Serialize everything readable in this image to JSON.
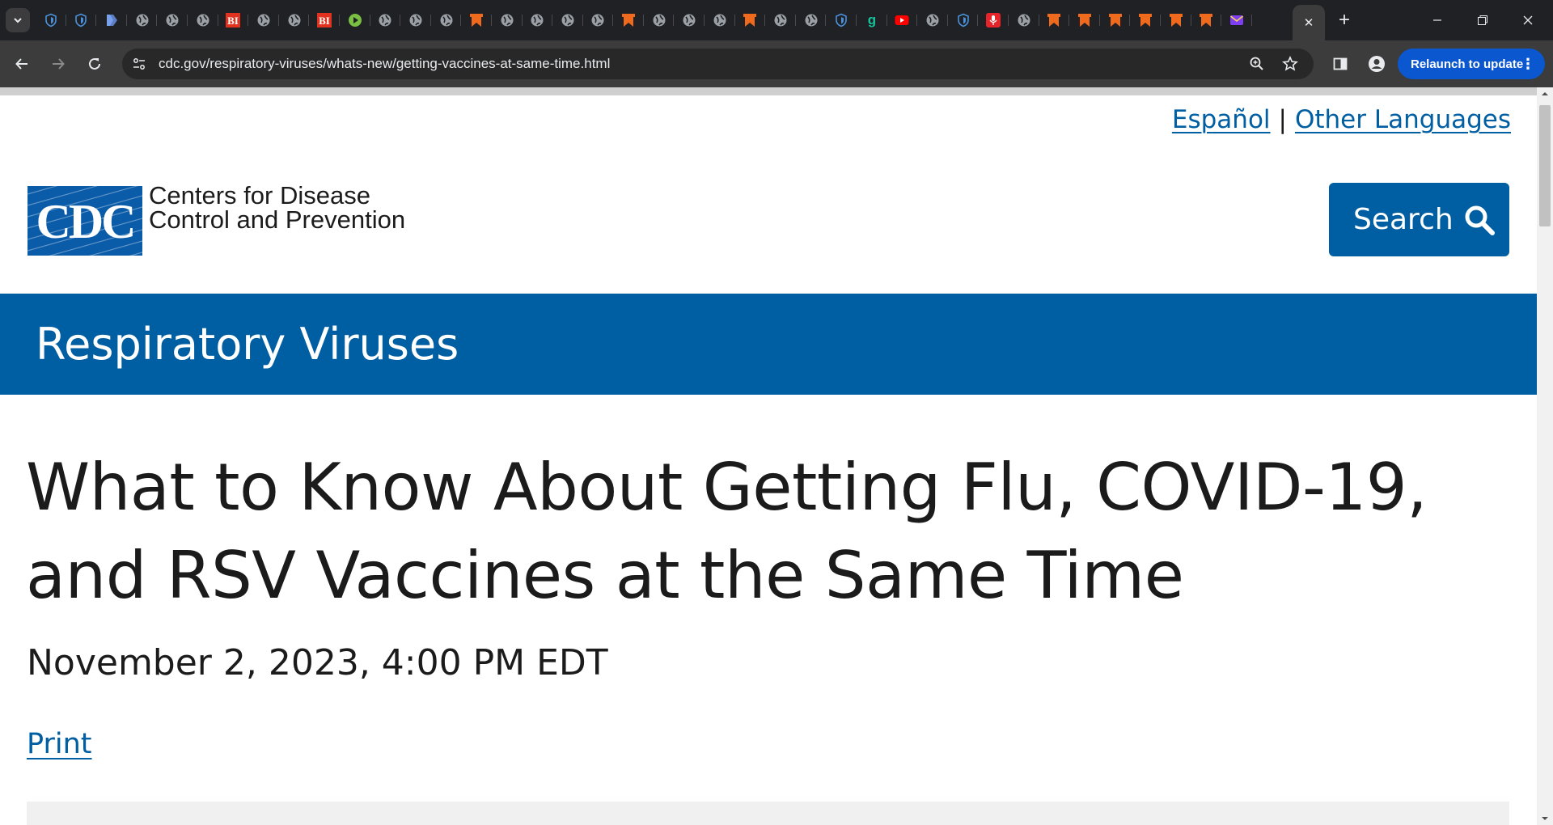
{
  "browser": {
    "tab_list_icon": "chevron-down-icon",
    "pinned_tabs": [
      {
        "icon": "shield-icon",
        "color": "#4a90d9"
      },
      {
        "icon": "shield-icon",
        "color": "#4a90d9"
      },
      {
        "icon": "bookmark-tag-icon",
        "color": "#5b7fc7"
      },
      {
        "icon": "globe-icon",
        "color": "#9aa0a6"
      },
      {
        "icon": "globe-icon",
        "color": "#9aa0a6"
      },
      {
        "icon": "globe-icon",
        "color": "#9aa0a6"
      },
      {
        "icon": "business-insider-icon",
        "color": "#e0321e",
        "text": "BI"
      },
      {
        "icon": "globe-icon",
        "color": "#9aa0a6"
      },
      {
        "icon": "globe-icon",
        "color": "#9aa0a6"
      },
      {
        "icon": "business-insider-icon",
        "color": "#e0321e",
        "text": "BI"
      },
      {
        "icon": "play-icon",
        "color": "#7ac043"
      },
      {
        "icon": "globe-icon",
        "color": "#9aa0a6"
      },
      {
        "icon": "globe-icon",
        "color": "#9aa0a6"
      },
      {
        "icon": "globe-icon",
        "color": "#9aa0a6"
      },
      {
        "icon": "bookmark-icon",
        "color": "#f06a1e"
      },
      {
        "icon": "globe-icon",
        "color": "#9aa0a6"
      },
      {
        "icon": "globe-icon",
        "color": "#9aa0a6"
      },
      {
        "icon": "globe-icon",
        "color": "#9aa0a6"
      },
      {
        "icon": "globe-icon",
        "color": "#9aa0a6"
      },
      {
        "icon": "bookmark-icon",
        "color": "#f06a1e"
      },
      {
        "icon": "globe-icon",
        "color": "#9aa0a6"
      },
      {
        "icon": "globe-icon",
        "color": "#9aa0a6"
      },
      {
        "icon": "globe-icon",
        "color": "#9aa0a6"
      },
      {
        "icon": "bookmark-icon",
        "color": "#f06a1e"
      },
      {
        "icon": "globe-icon",
        "color": "#9aa0a6"
      },
      {
        "icon": "globe-icon",
        "color": "#9aa0a6"
      },
      {
        "icon": "shield-icon",
        "color": "#4a90d9"
      },
      {
        "icon": "grammarly-icon",
        "color": "#15c39a",
        "text": "g"
      },
      {
        "icon": "youtube-icon",
        "color": "#ff0000"
      },
      {
        "icon": "globe-icon",
        "color": "#9aa0a6"
      },
      {
        "icon": "shield-icon",
        "color": "#4a90d9"
      },
      {
        "icon": "microphone-icon",
        "color": "#e8242b"
      },
      {
        "icon": "globe-icon",
        "color": "#9aa0a6"
      },
      {
        "icon": "bookmark-icon",
        "color": "#f06a1e"
      },
      {
        "icon": "bookmark-icon",
        "color": "#f06a1e"
      },
      {
        "icon": "bookmark-icon",
        "color": "#f06a1e"
      },
      {
        "icon": "bookmark-icon",
        "color": "#f06a1e"
      },
      {
        "icon": "bookmark-icon",
        "color": "#f06a1e"
      },
      {
        "icon": "bookmark-icon",
        "color": "#f06a1e"
      },
      {
        "icon": "mail-icon",
        "color": "#7e3ff2"
      }
    ],
    "active_tab_close": "✕",
    "new_tab": "+",
    "url": "cdc.gov/respiratory-viruses/whats-new/getting-vaccines-at-same-time.html",
    "relaunch_label": "Relaunch to update",
    "relaunch_menu": "⋮",
    "colors": {
      "chrome_dark": "#202124",
      "toolbar": "#3c3c3c",
      "relaunch": "#0b57d0"
    }
  },
  "page": {
    "lang_links": {
      "spanish": "Español",
      "separator": "|",
      "other": "Other Languages"
    },
    "logo_text": "CDC",
    "org_name_line1": "Centers for Disease",
    "org_name_line2": "Control and Prevention",
    "search_label": "Search",
    "site_section": "Respiratory Viruses",
    "title": "What to Know About Getting Flu, COVID-19, and RSV Vaccines at the Same Time",
    "date": "November 2, 2023, 4:00 PM EDT",
    "print_label": "Print",
    "colors": {
      "brand_blue": "#005ea2",
      "logo_blue": "#0a5ba8",
      "text": "#1b1b1b"
    }
  }
}
